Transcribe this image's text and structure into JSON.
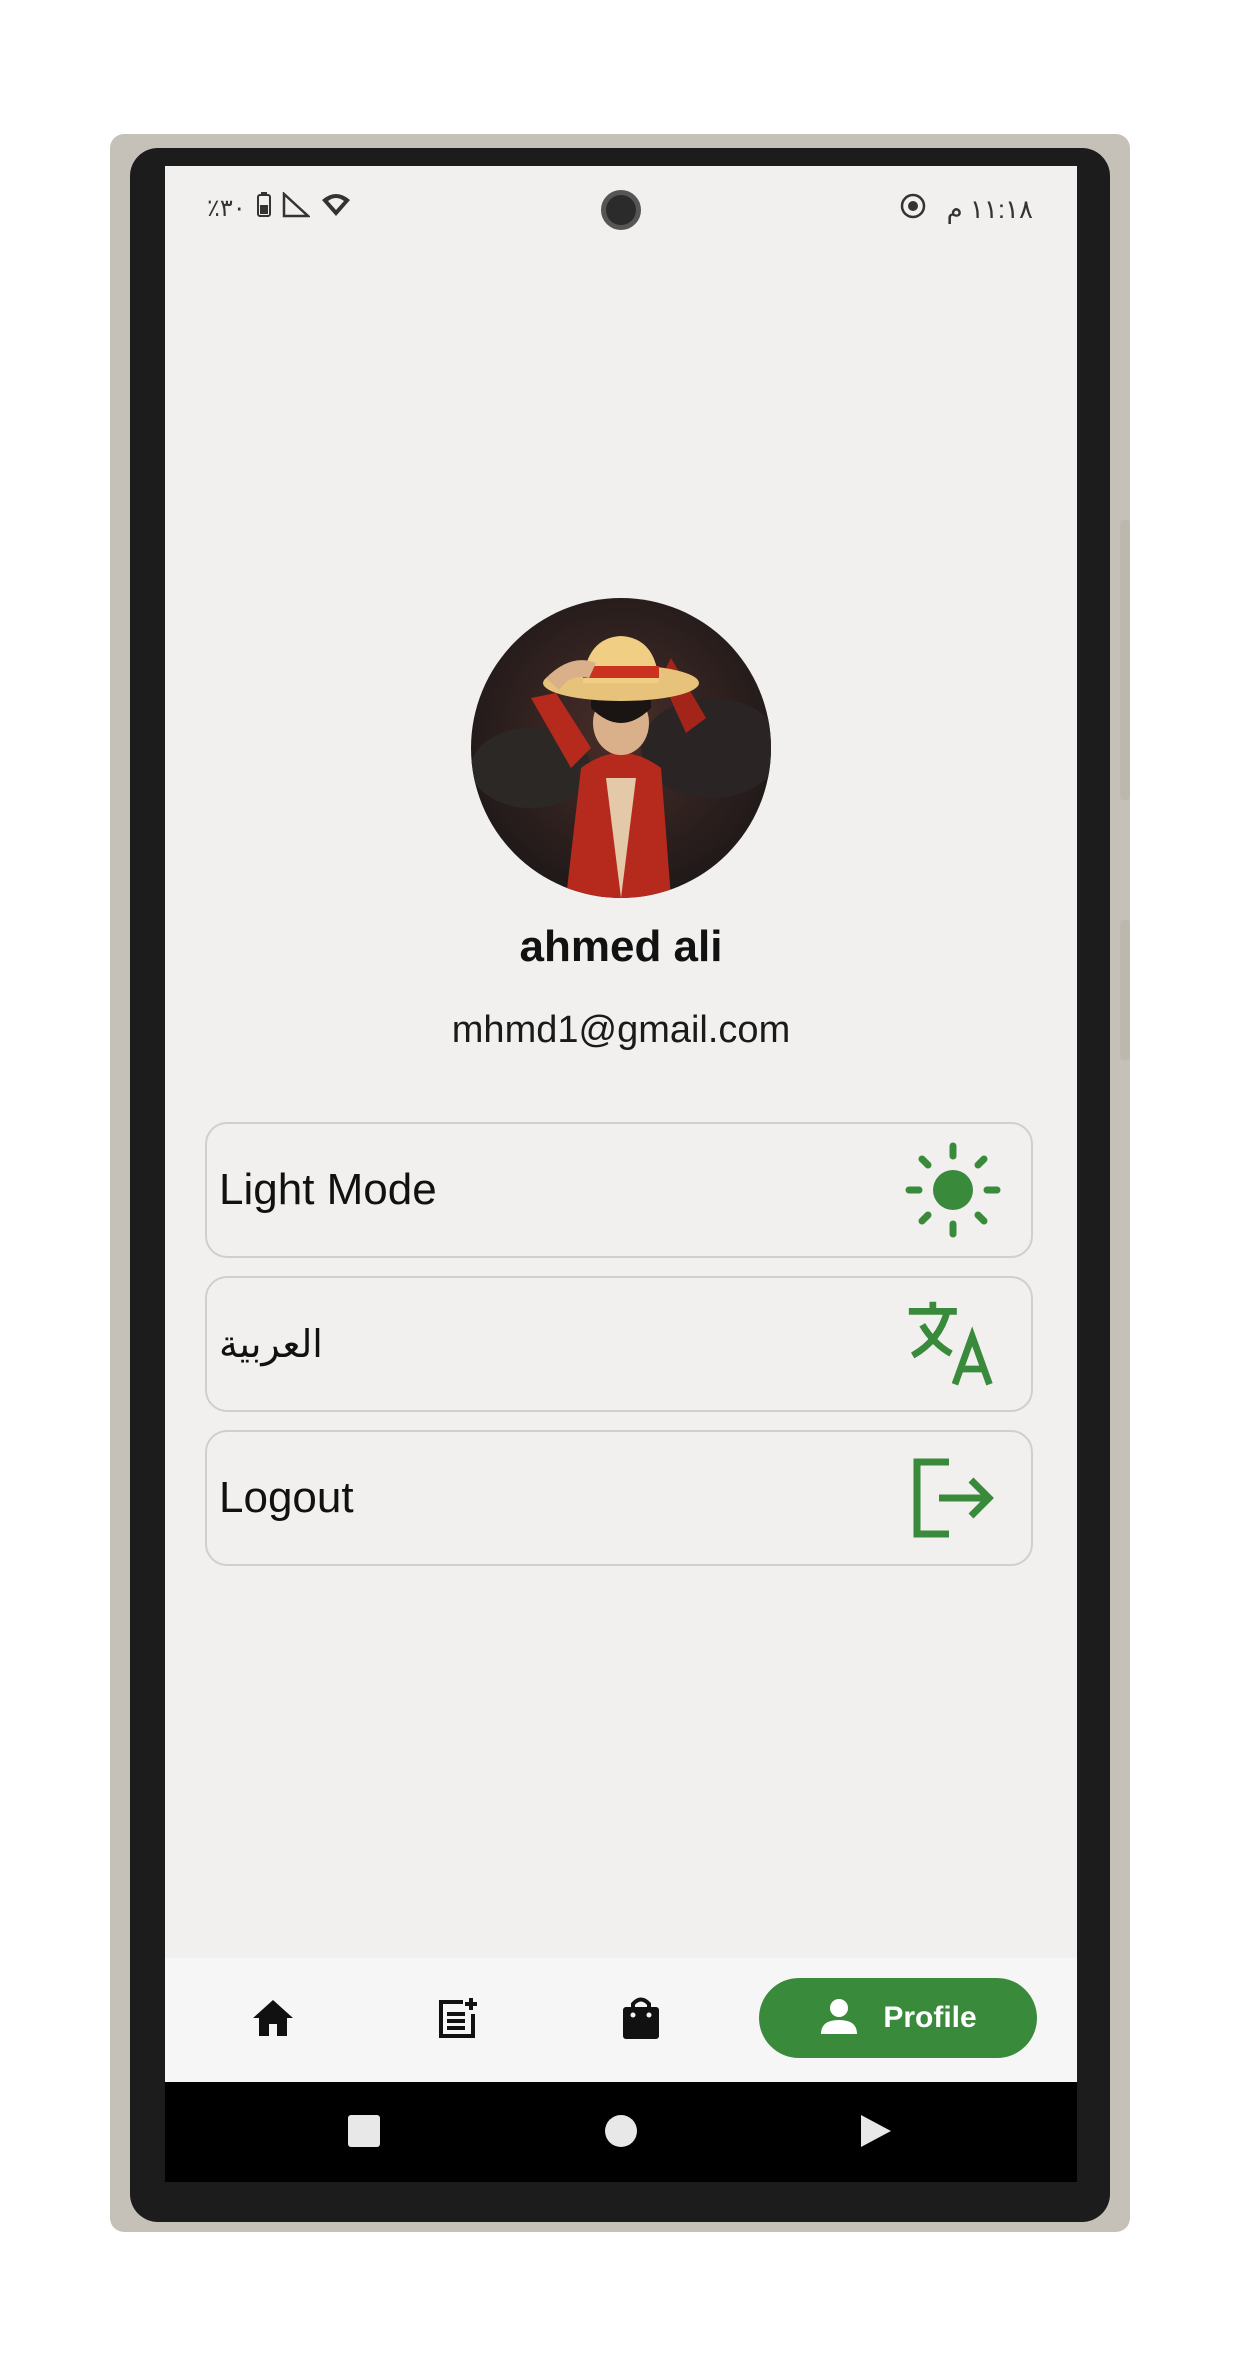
{
  "status_bar": {
    "battery_text": "٪٣٠",
    "time_text": "١١:١٨ م",
    "icons": [
      "battery-icon",
      "no-signal-icon",
      "wifi-icon",
      "screen-record-icon"
    ]
  },
  "profile": {
    "name": "ahmed ali",
    "email": "mhmd1@gmail.com",
    "avatar": "avatar-image"
  },
  "options": [
    {
      "label": "Light Mode",
      "icon": "sun-icon"
    },
    {
      "label": "العربية",
      "icon": "translate-icon"
    },
    {
      "label": "Logout",
      "icon": "logout-icon"
    }
  ],
  "bottom_nav": {
    "items": [
      {
        "icon": "home-icon"
      },
      {
        "icon": "post-add-icon"
      },
      {
        "icon": "shopping-bag-icon"
      }
    ],
    "active": {
      "label": "Profile",
      "icon": "person-icon"
    }
  },
  "system_nav": [
    "recents-icon",
    "home-circle-icon",
    "back-icon"
  ],
  "colors": {
    "accent": "#3a8a3c",
    "background": "#f1f0ef",
    "option_border": "#cfcfcf"
  }
}
